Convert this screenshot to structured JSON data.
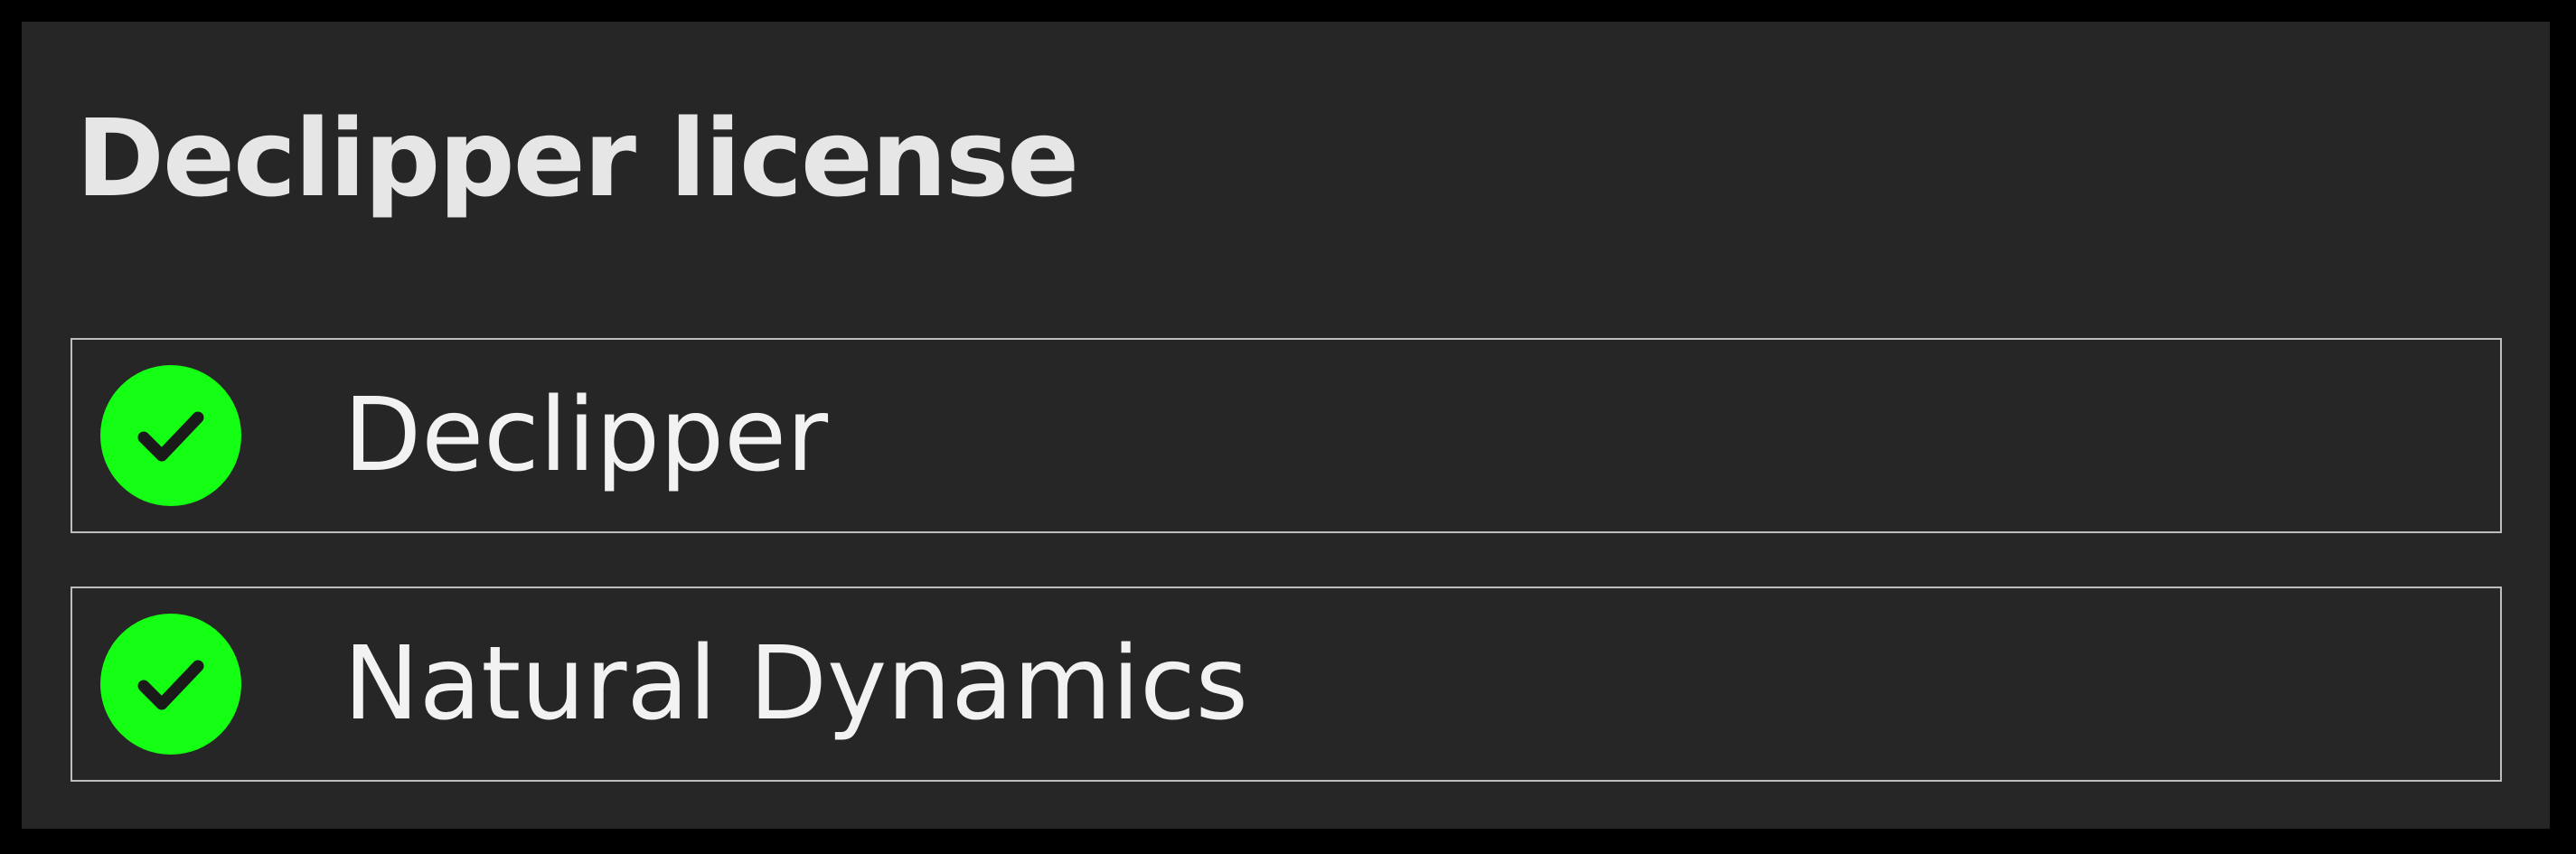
{
  "title": "Declipper license",
  "licenses": [
    {
      "label": "Declipper",
      "status": "licensed",
      "icon": "check-icon"
    },
    {
      "label": "Natural Dynamics",
      "status": "licensed",
      "icon": "check-icon"
    }
  ],
  "colors": {
    "background": "#262626",
    "frame": "#000000",
    "check": "#14ff14",
    "text": "#f2f2f2",
    "border": "#bdbdbd"
  }
}
